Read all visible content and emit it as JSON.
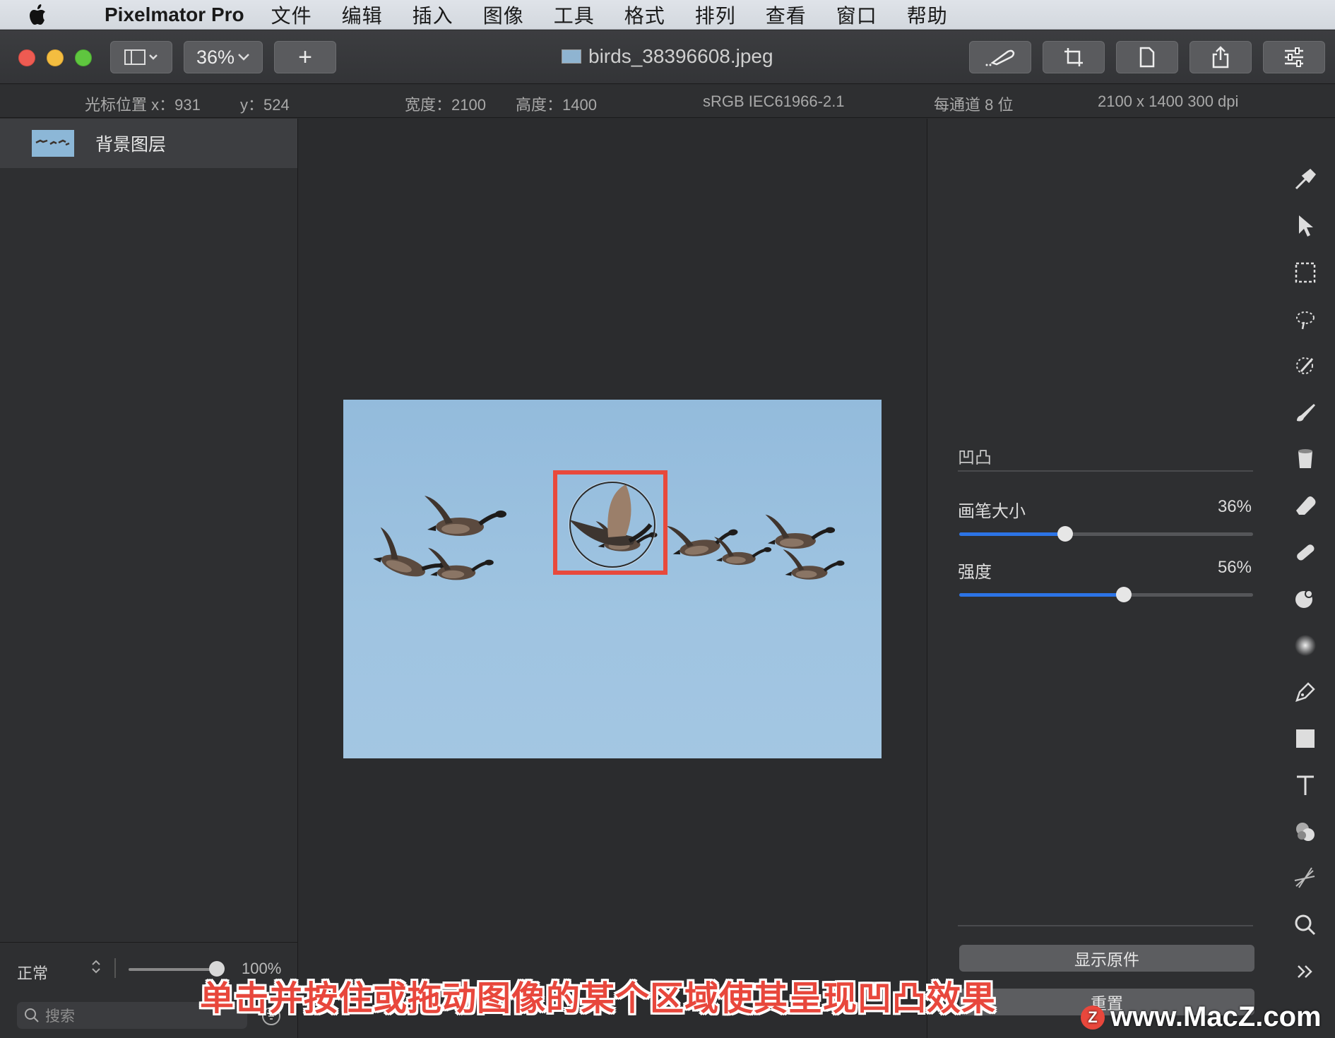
{
  "menubar": {
    "app_name": "Pixelmator Pro",
    "items": [
      "文件",
      "编辑",
      "插入",
      "图像",
      "工具",
      "格式",
      "排列",
      "查看",
      "窗口",
      "帮助"
    ]
  },
  "toolbar": {
    "zoom": "36%",
    "add_label": "+",
    "document_title": "birds_38396608.jpeg"
  },
  "infobar": {
    "cursor_x": "光标位置 x：931",
    "cursor_y": "y：524",
    "width": "宽度：2100",
    "height": "高度：1400",
    "color_profile": "sRGB IEC61966-2.1",
    "bit_depth": "每通道 8 位",
    "dimensions": "2100 x 1400 300 dpi"
  },
  "layers": {
    "items": [
      {
        "name": "背景图层"
      }
    ],
    "blend_mode": "正常",
    "opacity": "100%",
    "opacity_value": 1.0,
    "search_placeholder": "搜索"
  },
  "settings": {
    "tool_title": "凹凸",
    "brush_size": {
      "label": "画笔大小",
      "value": "36%",
      "fraction": 0.36
    },
    "strength": {
      "label": "强度",
      "value": "56%",
      "fraction": 0.56
    },
    "show_original_label": "显示原件",
    "reset_label": "重置"
  },
  "tools": [
    "style-brush",
    "arrange",
    "selection",
    "magic-selection",
    "quick-selection",
    "paint",
    "fill",
    "erase",
    "repair",
    "distort",
    "retouch",
    "pen",
    "shape",
    "type",
    "color-adjust",
    "effects",
    "zoom",
    "more"
  ],
  "overlay": {
    "caption": "单击并按住或拖动图像的某个区域使其呈现凹凸效果",
    "watermark": "www.MacZ.com",
    "watermark_logo": "Z"
  },
  "colors": {
    "accent": "#2c74e6",
    "highlight": "#e8493c",
    "sky": "#9fc4e1"
  }
}
